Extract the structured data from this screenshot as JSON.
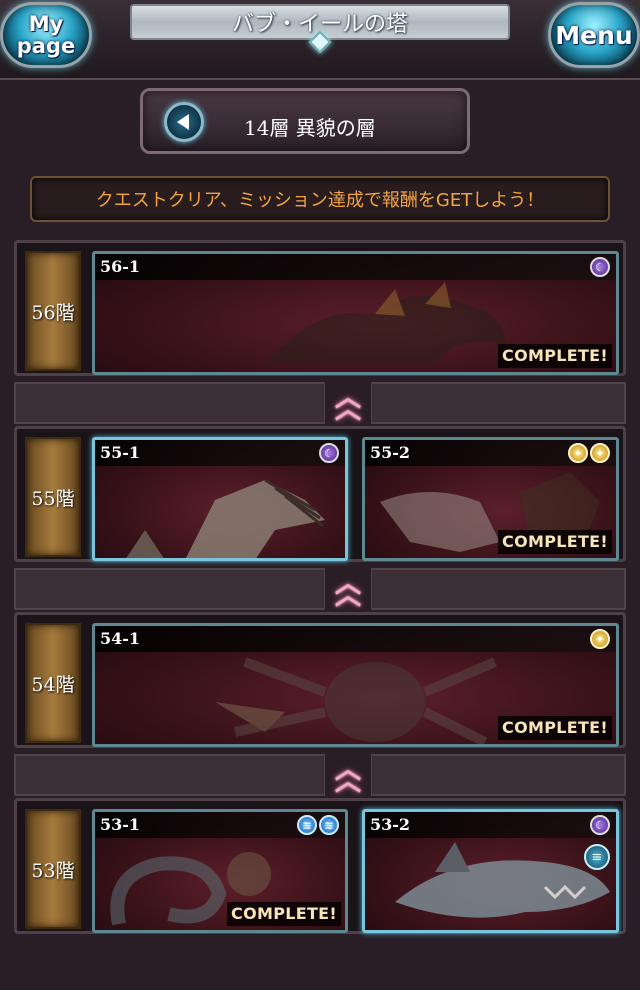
{
  "header": {
    "mypage_label": "My page",
    "menu_label": "Menu",
    "title": "バブ・イールの塔"
  },
  "subheader": {
    "title": "14層 異貌の層"
  },
  "banner": {
    "text": "クエストクリア、ミッション達成で報酬をGETしよう！"
  },
  "floors": [
    {
      "label": "56階",
      "quests": [
        {
          "id": "56-1",
          "status": "COMPLETE!",
          "elements": [
            "dark"
          ]
        }
      ]
    },
    {
      "label": "55階",
      "quests": [
        {
          "id": "55-1",
          "status": "",
          "elements": [
            "dark"
          ]
        },
        {
          "id": "55-2",
          "status": "COMPLETE!",
          "elements": [
            "light",
            "light"
          ]
        }
      ]
    },
    {
      "label": "54階",
      "quests": [
        {
          "id": "54-1",
          "status": "COMPLETE!",
          "elements": [
            "light"
          ]
        }
      ]
    },
    {
      "label": "53階",
      "quests": [
        {
          "id": "53-1",
          "status": "COMPLETE!",
          "elements": [
            "water",
            "water"
          ]
        },
        {
          "id": "53-2",
          "status": "",
          "elements": [
            "dark"
          ],
          "extra_icon": "scroll-icon"
        }
      ]
    }
  ],
  "colors": {
    "accent_orange": "#f2a545",
    "frame_teal": "#5d8892",
    "chevron_pink": "#f2a9c4"
  }
}
